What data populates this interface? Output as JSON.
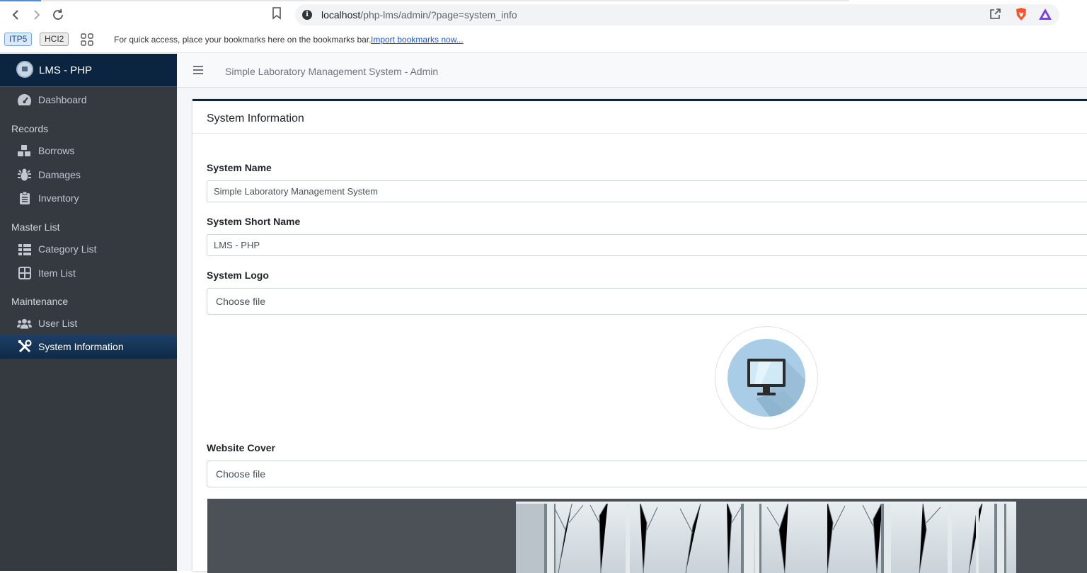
{
  "browser": {
    "url_host": "localhost",
    "url_path": "/php-lms/admin/?page=system_info",
    "bookmarks": {
      "chips": [
        "ITP5",
        "HCI2"
      ],
      "message": "For quick access, place your bookmarks here on the bookmarks bar.",
      "import_link": "Import bookmarks now..."
    }
  },
  "sidebar": {
    "brand": "LMS - PHP",
    "dashboard": "Dashboard",
    "sections": {
      "records": "Records",
      "master_list": "Master List",
      "maintenance": "Maintenance"
    },
    "items": {
      "borrows": "Borrows",
      "damages": "Damages",
      "inventory": "Inventory",
      "category_list": "Category List",
      "item_list": "Item List",
      "user_list": "User List",
      "system_information": "System Information"
    },
    "active_item": "System Information",
    "active_color": "#17375a"
  },
  "topbar": {
    "title": "Simple Laboratory Management System - Admin"
  },
  "form": {
    "card_title": "System Information",
    "system_name": {
      "label": "System Name",
      "value": "Simple Laboratory Management System"
    },
    "system_short_name": {
      "label": "System Short Name",
      "value": "LMS - PHP"
    },
    "system_logo": {
      "label": "System Logo",
      "file_button": "Choose file"
    },
    "website_cover": {
      "label": "Website Cover",
      "file_button": "Choose file"
    }
  },
  "colors": {
    "brand_dark": "#0b2440",
    "sidebar_bg": "#343a40",
    "content_bg": "#f4f6f9"
  }
}
